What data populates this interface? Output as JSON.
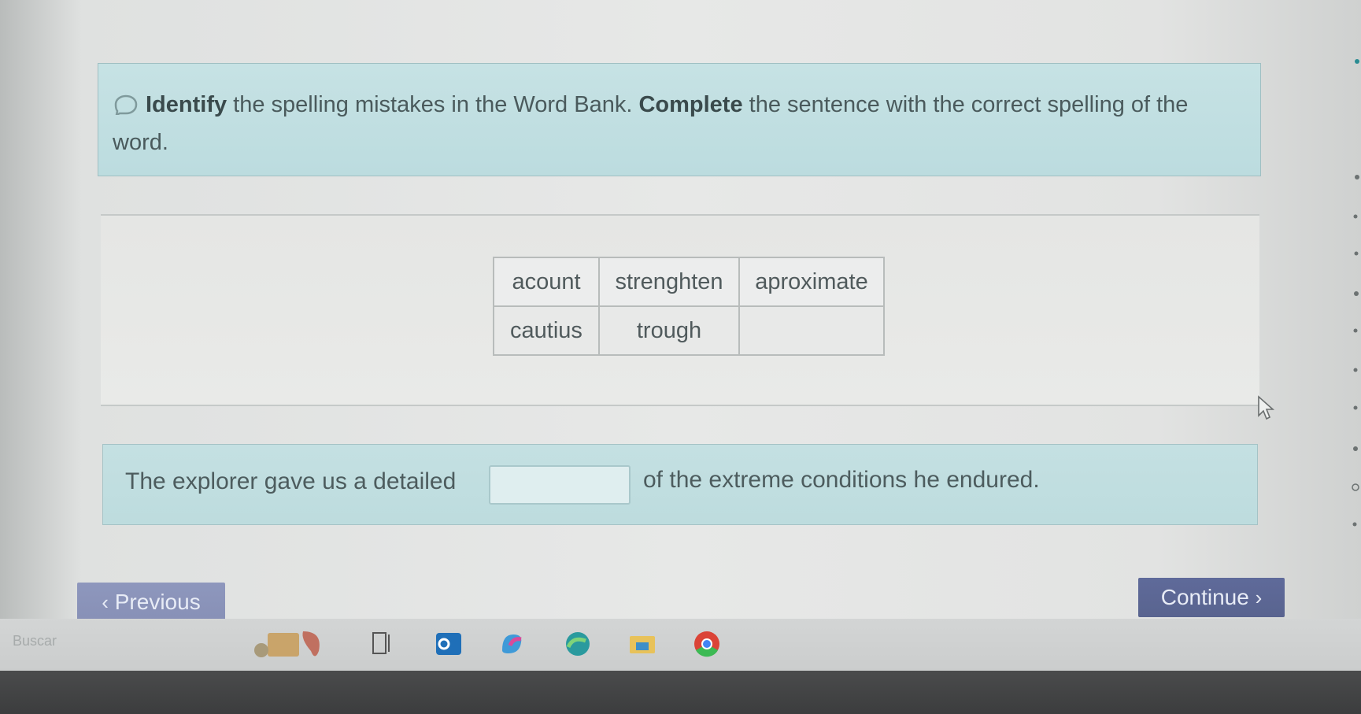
{
  "instructions": {
    "verb1": "Identify",
    "text1": " the spelling mistakes in the Word Bank. ",
    "verb2": "Complete",
    "text2": " the sentence with the correct spelling of the word."
  },
  "word_bank": {
    "rows": [
      [
        "acount",
        "strenghten",
        "aproximate"
      ],
      [
        "cautius",
        "trough",
        ""
      ]
    ]
  },
  "sentence": {
    "part1": "The explorer gave us a detailed",
    "answer_value": "",
    "part2": "of the extreme conditions he endured."
  },
  "navigation": {
    "previous_label": "Previous",
    "continue_label": "Continue"
  },
  "taskbar": {
    "search_text": "Buscar"
  },
  "colors": {
    "instruction_bg": "#bcdcdf",
    "previous_button": "#8790b6",
    "continue_button": "#5f6a9a"
  },
  "icons": [
    "speaker-icon",
    "cursor-icon",
    "chevron-left-icon",
    "chevron-right-icon"
  ]
}
